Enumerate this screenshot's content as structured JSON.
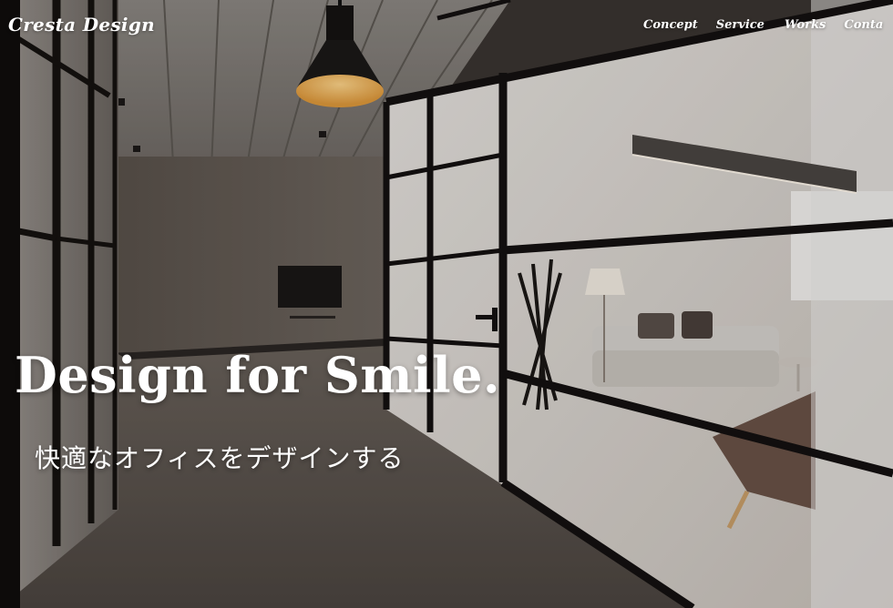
{
  "brand": {
    "name": "Cresta Design"
  },
  "nav": {
    "items": [
      "Concept",
      "Service",
      "Works",
      "Conta"
    ]
  },
  "hero": {
    "headline": "Design for Smile.",
    "subheadline": "快適なオフィスをデザインする"
  }
}
